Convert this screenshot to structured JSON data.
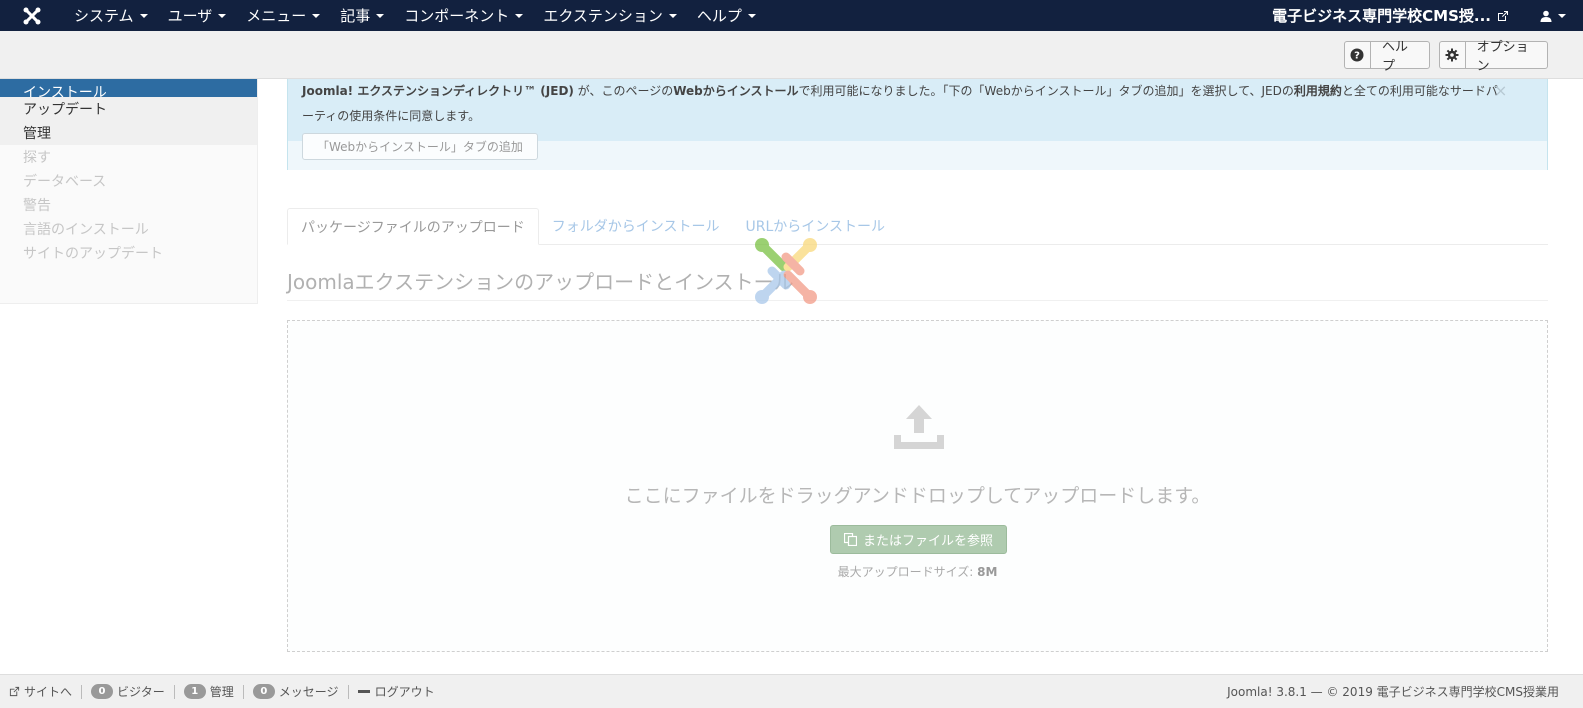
{
  "navbar": {
    "menu": [
      {
        "label": "システム"
      },
      {
        "label": "ユーザ"
      },
      {
        "label": "メニュー"
      },
      {
        "label": "記事"
      },
      {
        "label": "コンポーネント"
      },
      {
        "label": "エクステンション"
      },
      {
        "label": "ヘルプ"
      }
    ],
    "site_name": "電子ビジネス専門学校CMS授..."
  },
  "toolbar": {
    "help_label": "ヘルプ",
    "options_label": "オプション"
  },
  "sidebar": {
    "items": [
      {
        "label": "インストール"
      },
      {
        "label": "アップデート"
      },
      {
        "label": "管理"
      },
      {
        "label": "探す"
      },
      {
        "label": "データベース"
      },
      {
        "label": "警告"
      },
      {
        "label": "言語のインストール"
      },
      {
        "label": "サイトのアップデート"
      }
    ]
  },
  "alert": {
    "jed_name": "Joomla! エクステンションディレクトリ™ (JED)",
    "text_1": " が、このページの",
    "web_install": "Webからインストール",
    "text_2": "で利用可能になりました。「下の「Webからインストール」タブの追加」を選択して、JEDの",
    "terms": "利用規約",
    "text_3": "と全ての利用可能なサードパーティの使用条件に同意します。",
    "close_symbol": "×",
    "add_tab_button": "「Webからインストール」タブの追加"
  },
  "tabs": [
    {
      "label": "パッケージファイルのアップロード"
    },
    {
      "label": "フォルダからインストール"
    },
    {
      "label": "URLからインストール"
    }
  ],
  "upload": {
    "section_title": "Joomlaエクステンションのアップロードとインストール",
    "drop_text": "ここにファイルをドラッグアンドドロップしてアップロードします。",
    "browse_button": "またはファイルを参照",
    "max_size_label": "最大アップロードサイズ: ",
    "max_size_value": "8M"
  },
  "footer": {
    "site_link": "サイトへ",
    "visitors_count": "0",
    "visitors_label": "ビジター",
    "admins_count": "1",
    "admins_label": "管理",
    "messages_count": "0",
    "messages_label": "メッセージ",
    "logout": "ログアウト",
    "version": "Joomla! 3.8.1 — © 2019 電子ビジネス専門学校CMS授業用"
  },
  "colors": {
    "navbar_bg": "#12213f",
    "sidebar_active": "#2d6ca2",
    "alert_bg": "#d9edf7",
    "browse_button_bg": "#afcbaf"
  }
}
